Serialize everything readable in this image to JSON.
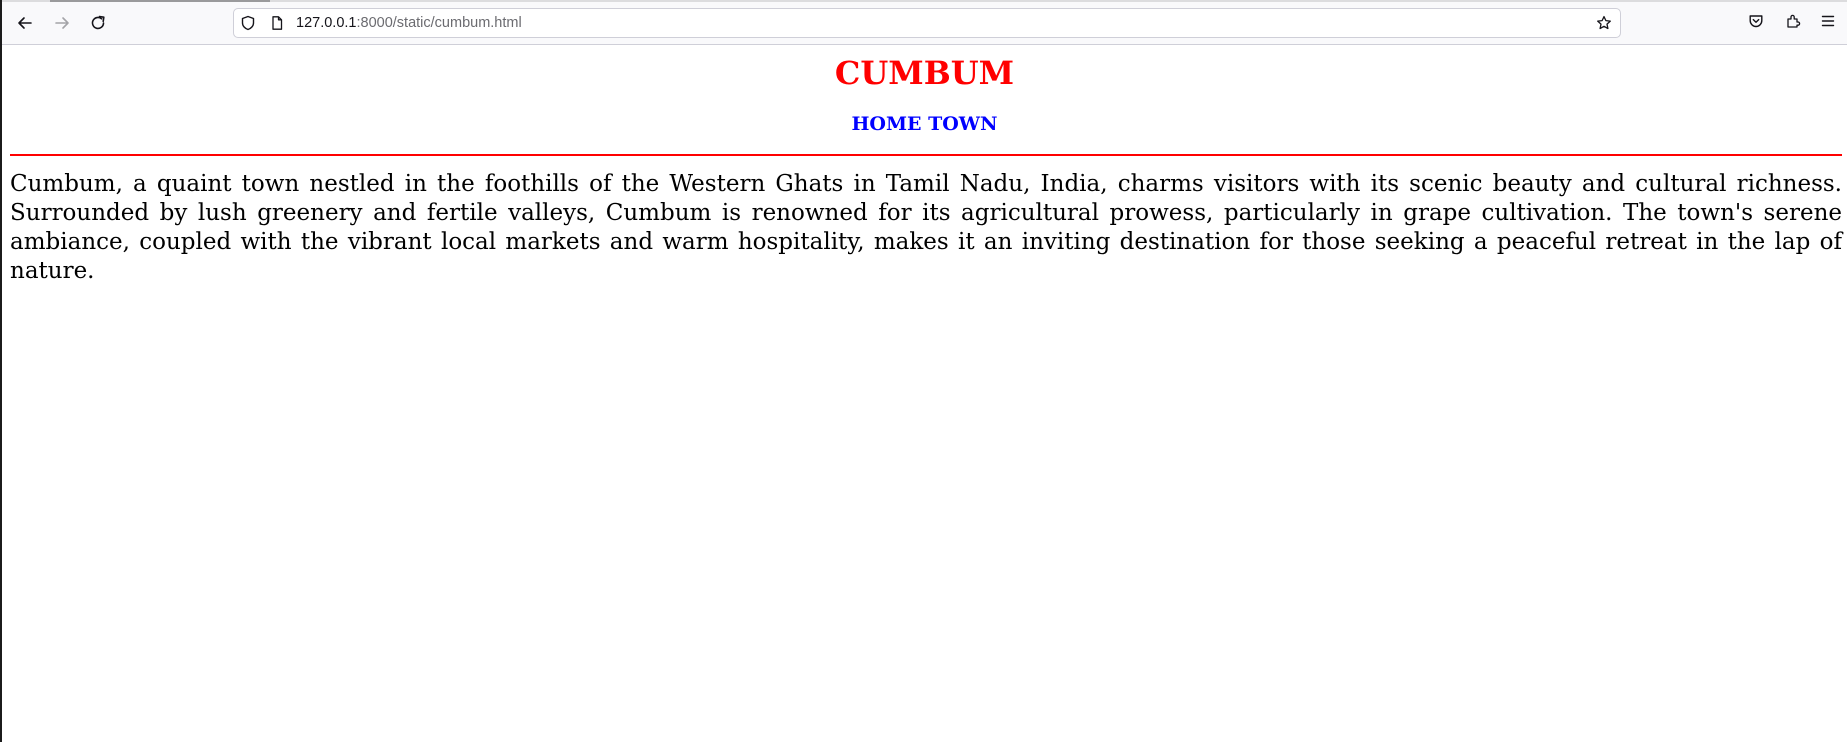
{
  "browser": {
    "url_host": "127.0.0.1",
    "url_rest": ":8000/static/cumbum.html",
    "icons": {
      "back": "back-arrow-icon",
      "forward": "forward-arrow-icon",
      "reload": "reload-icon",
      "shield": "tracking-protection-shield-icon",
      "page": "page-icon",
      "bookmark": "bookmark-star-icon",
      "pocket": "pocket-icon",
      "extensions": "extensions-icon",
      "menu": "hamburger-menu-icon"
    }
  },
  "page": {
    "title": "CUMBUM",
    "subtitle": "HOME TOWN",
    "description": "Cumbum, a quaint town nestled in the foothills of the Western Ghats in Tamil Nadu, India, charms visitors with its scenic beauty and cultural richness. Surrounded by lush greenery and fertile valleys, Cumbum is renowned for its agricultural prowess, particularly in grape cultivation. The town's serene ambiance, coupled with the vibrant local markets and warm hospitality, makes it an inviting destination for those seeking a peaceful retreat in the lap of nature.",
    "colors": {
      "title": "#ff0000",
      "subtitle": "#0000ff",
      "rule": "#ff0000"
    }
  }
}
